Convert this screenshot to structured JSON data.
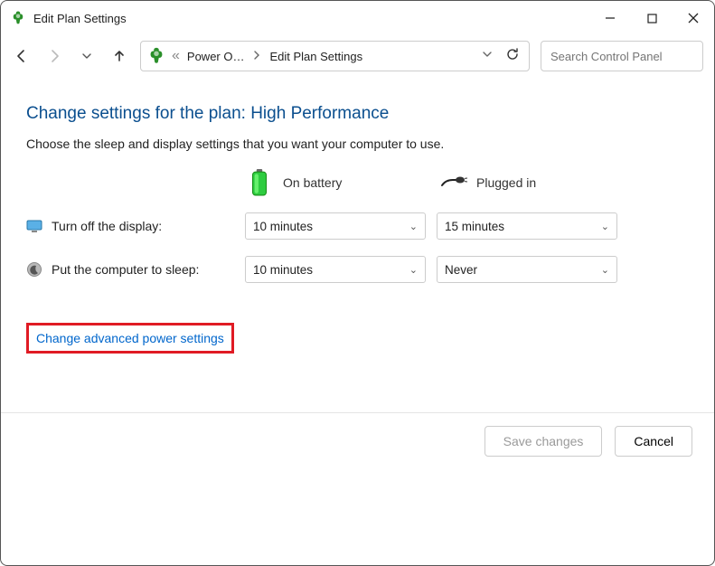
{
  "titlebar": {
    "title": "Edit Plan Settings"
  },
  "breadcrumb": {
    "prefix": "«",
    "parts": [
      "Power O…",
      "Edit Plan Settings"
    ]
  },
  "search": {
    "placeholder": "Search Control Panel"
  },
  "page": {
    "heading": "Change settings for the plan: High Performance",
    "description": "Choose the sleep and display settings that you want your computer to use."
  },
  "columns": {
    "battery": "On battery",
    "plugged": "Plugged in"
  },
  "rows": {
    "display": {
      "label": "Turn off the display:",
      "battery": "10 minutes",
      "plugged": "15 minutes"
    },
    "sleep": {
      "label": "Put the computer to sleep:",
      "battery": "10 minutes",
      "plugged": "Never"
    }
  },
  "links": {
    "advanced": "Change advanced power settings"
  },
  "buttons": {
    "save": "Save changes",
    "cancel": "Cancel"
  }
}
